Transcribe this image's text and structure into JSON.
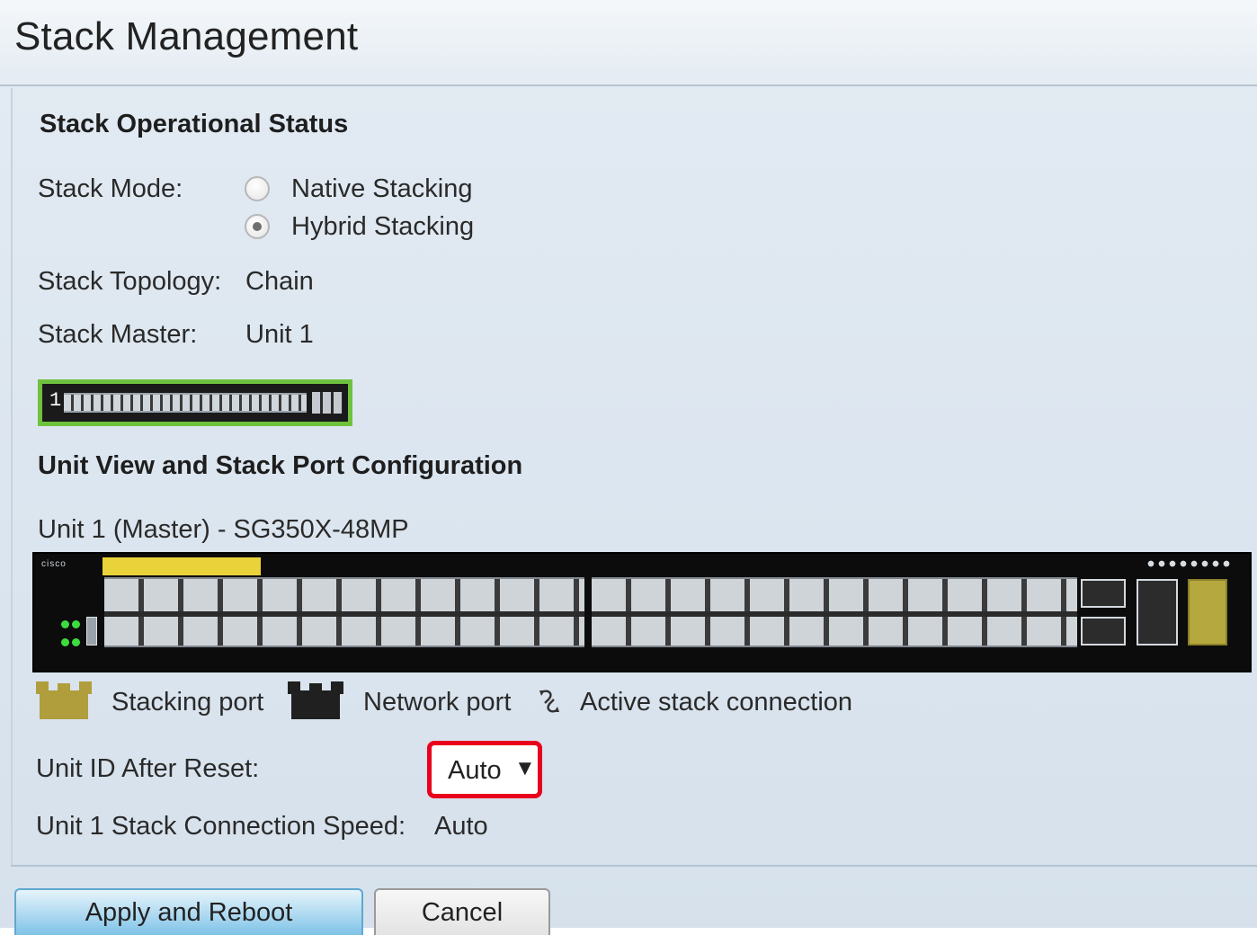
{
  "page": {
    "title": "Stack Management"
  },
  "operational_status": {
    "heading": "Stack Operational Status",
    "stack_mode_label": "Stack Mode:",
    "stack_mode_options": [
      {
        "label": "Native Stacking",
        "selected": false
      },
      {
        "label": "Hybrid Stacking",
        "selected": true
      }
    ],
    "topology_label": "Stack Topology:",
    "topology_value": "Chain",
    "master_label": "Stack Master:",
    "master_value": "Unit 1",
    "stack_thumbnail_unit": "1"
  },
  "unit_view": {
    "heading": "Unit View and Stack Port Configuration",
    "unit_title": "Unit 1 (Master) - SG350X-48MP",
    "panel_logo": "cisco"
  },
  "legend": {
    "stacking_port": "Stacking port",
    "network_port": "Network port",
    "active_connection": "Active stack connection"
  },
  "unit_id_after_reset": {
    "label": "Unit ID After Reset:",
    "selected": "Auto"
  },
  "connection_speed": {
    "label": "Unit 1 Stack Connection Speed:",
    "value": "Auto"
  },
  "buttons": {
    "apply": "Apply and Reboot",
    "cancel": "Cancel"
  },
  "colors": {
    "highlight_border": "#e8001d",
    "thumbnail_border": "#6fc23d",
    "stacking_port": "#b09e3d",
    "network_port": "#202020"
  }
}
